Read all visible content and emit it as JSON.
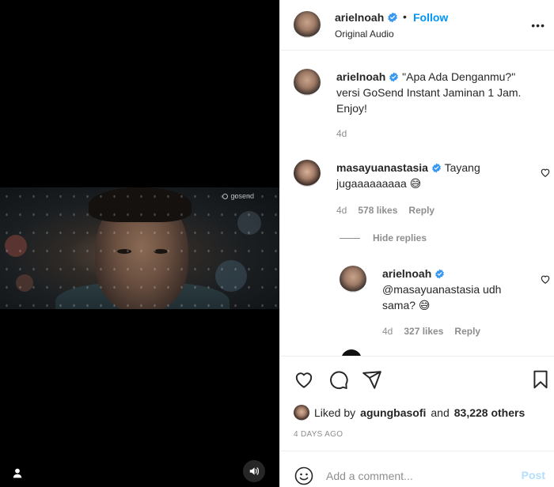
{
  "media": {
    "watermark": "gosend",
    "icons": {
      "user_tag": "user-icon",
      "sound": "speaker-icon"
    }
  },
  "header": {
    "username": "arielnoah",
    "dot": "•",
    "follow_label": "Follow",
    "subtitle": "Original Audio",
    "more": "•••"
  },
  "caption": {
    "username": "arielnoah",
    "text": "\"Apa Ada Denganmu?\" versi GoSend Instant Jaminan 1 Jam. Enjoy!",
    "time": "4d"
  },
  "comments": [
    {
      "username": "masayuanastasia",
      "text": "Tayang jugaaaaaaaaa 😅",
      "time": "4d",
      "likes": "578 likes",
      "reply_label": "Reply"
    }
  ],
  "hide_replies": "Hide replies",
  "replies": [
    {
      "username": "arielnoah",
      "text": "@masayuanastasia udh sama? 😅",
      "time": "4d",
      "likes": "327 likes",
      "reply_label": "Reply"
    }
  ],
  "actions": {
    "icons": [
      "heart-icon",
      "comment-icon",
      "share-icon",
      "bookmark-icon"
    ]
  },
  "liked_by": {
    "prefix": "Liked by",
    "user": "agungbasofi",
    "conj": "and",
    "others": "83,228 others"
  },
  "date": "4 DAYS AGO",
  "composer": {
    "placeholder": "Add a comment...",
    "post_label": "Post"
  },
  "colors": {
    "accent": "#0095f6",
    "verified": "#3897f0",
    "muted": "#8e8e8e",
    "post_disabled": "#b2dffc"
  }
}
